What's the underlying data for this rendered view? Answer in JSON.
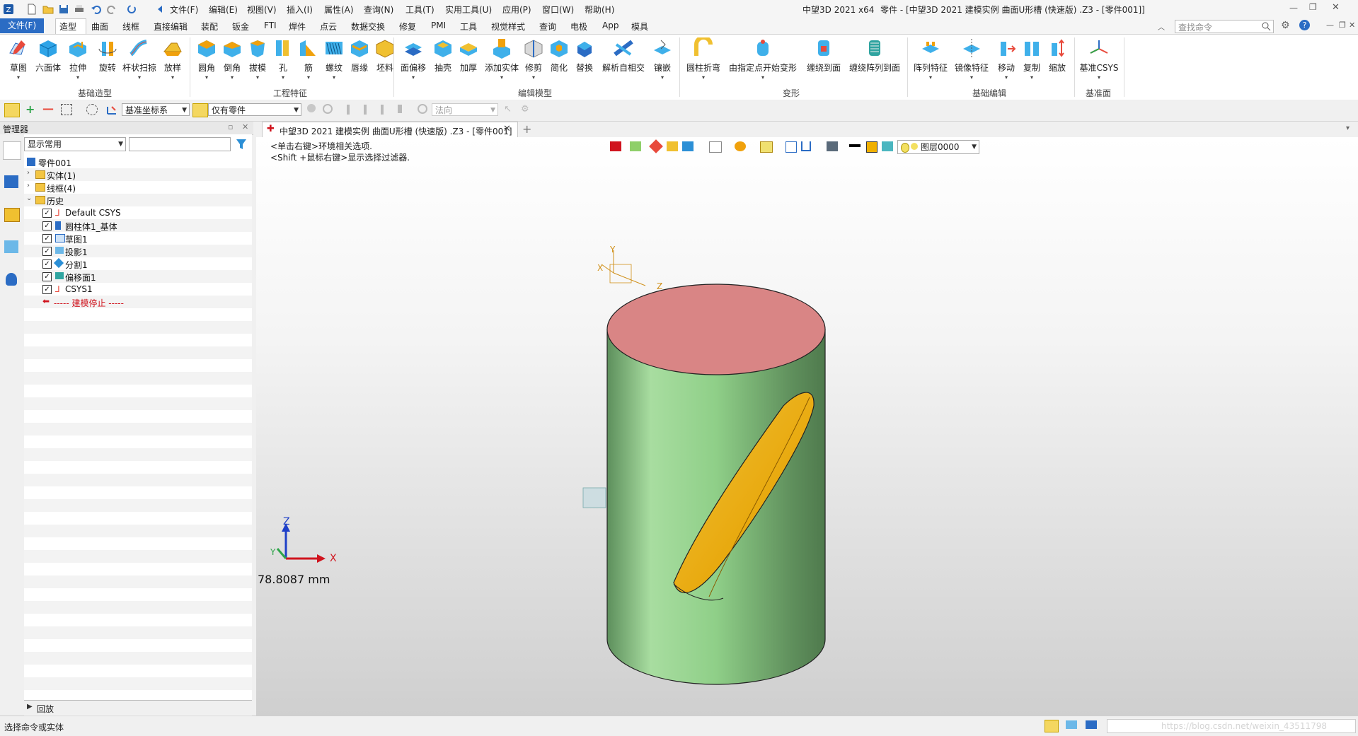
{
  "quick_access": {
    "icons": [
      "app-logo-icon",
      "new-file-icon",
      "open-folder-icon",
      "save-icon",
      "print-icon",
      "undo-icon",
      "redo-icon",
      "refresh-icon"
    ]
  },
  "menu": [
    "文件(F)",
    "编辑(E)",
    "视图(V)",
    "插入(I)",
    "属性(A)",
    "查询(N)",
    "工具(T)",
    "实用工具(U)",
    "应用(P)",
    "窗口(W)",
    "帮助(H)"
  ],
  "window": {
    "app_name": "中望3D 2021 x64",
    "title": "零件 - [中望3D 2021 建模实例 曲面U形槽 (快速版) .Z3 - [零件001]]",
    "search_placeholder": "查找命令"
  },
  "ribbon_tabs": {
    "file": "文件(F)",
    "items": [
      "造型",
      "曲面",
      "线框",
      "直接编辑",
      "装配",
      "钣金",
      "FTI",
      "焊件",
      "点云",
      "数据交换",
      "修复",
      "PMI",
      "工具",
      "视觉样式",
      "查询",
      "电极",
      "App",
      "模具"
    ],
    "active": "造型"
  },
  "ribbon": {
    "basic_shape": {
      "label": "基础造型",
      "buttons": [
        "草图",
        "六面体",
        "拉伸",
        "旋转",
        "杆状扫掠",
        "放样"
      ]
    },
    "eng_feature": {
      "label": "工程特征",
      "buttons": [
        "圆角",
        "倒角",
        "拔模",
        "孔",
        "筋",
        "螺纹",
        "唇缘",
        "坯料"
      ]
    },
    "edit_model": {
      "label": "编辑模型",
      "buttons": [
        "面偏移",
        "抽壳",
        "加厚",
        "添加实体",
        "修剪",
        "简化",
        "替换",
        "解析自相交",
        "镶嵌"
      ]
    },
    "deform": {
      "label": "变形",
      "buttons": [
        "圆柱折弯",
        "由指定点开始变形",
        "缠绕到面",
        "缠绕阵列到面"
      ]
    },
    "basic_edit": {
      "label": "基础编辑",
      "buttons": [
        "阵列特征",
        "镜像特征",
        "移动",
        "复制",
        "缩放"
      ]
    },
    "datum": {
      "label": "基准面",
      "buttons": [
        "基准CSYS"
      ]
    }
  },
  "toolbar2": {
    "csys_combo": "基准坐标系",
    "filter_combo": "仅有零件",
    "normal_combo": "法向"
  },
  "manager": {
    "title": "管理器",
    "filter_combo": "显示常用",
    "filter_input": ""
  },
  "tree": {
    "root": "零件001",
    "items": [
      {
        "text": "实体(1)",
        "icon": "folder-icon"
      },
      {
        "text": "线框(4)",
        "icon": "folder-icon"
      },
      {
        "text": "历史",
        "icon": "folder-icon"
      }
    ],
    "history": [
      {
        "text": "Default CSYS",
        "icon": "csys-icon"
      },
      {
        "text": "圆柱体1_基体",
        "icon": "cylinder-icon"
      },
      {
        "text": "草图1",
        "icon": "sketch-icon"
      },
      {
        "text": "投影1",
        "icon": "projection-icon"
      },
      {
        "text": "分割1",
        "icon": "split-icon"
      },
      {
        "text": "偏移面1",
        "icon": "offset-face-icon"
      },
      {
        "text": "CSYS1",
        "icon": "csys-icon"
      }
    ],
    "stop": "----- 建模停止 -----",
    "replay": "回放"
  },
  "document": {
    "tab_label": "中望3D 2021 建模实例 曲面U形槽 (快速版) .Z3 - [零件001]"
  },
  "viewport": {
    "hint1": "<单击右键>环境相关选项.",
    "hint2": "<Shift +鼠标右键>显示选择过滤器.",
    "layer_combo": "图层0000",
    "measure": "78.8087 mm",
    "axis_x": "X",
    "axis_y": "Y",
    "axis_z": "Z"
  },
  "status": {
    "text": "选择命令或实体",
    "watermark": "https://blog.csdn.net/weixin_43511798"
  },
  "colors": {
    "accent": "#2b6cc4",
    "cylinder": "#8fd48c",
    "top_face": "#d98585",
    "slot": "#e8a90e",
    "stop_red": "#d0141e"
  }
}
